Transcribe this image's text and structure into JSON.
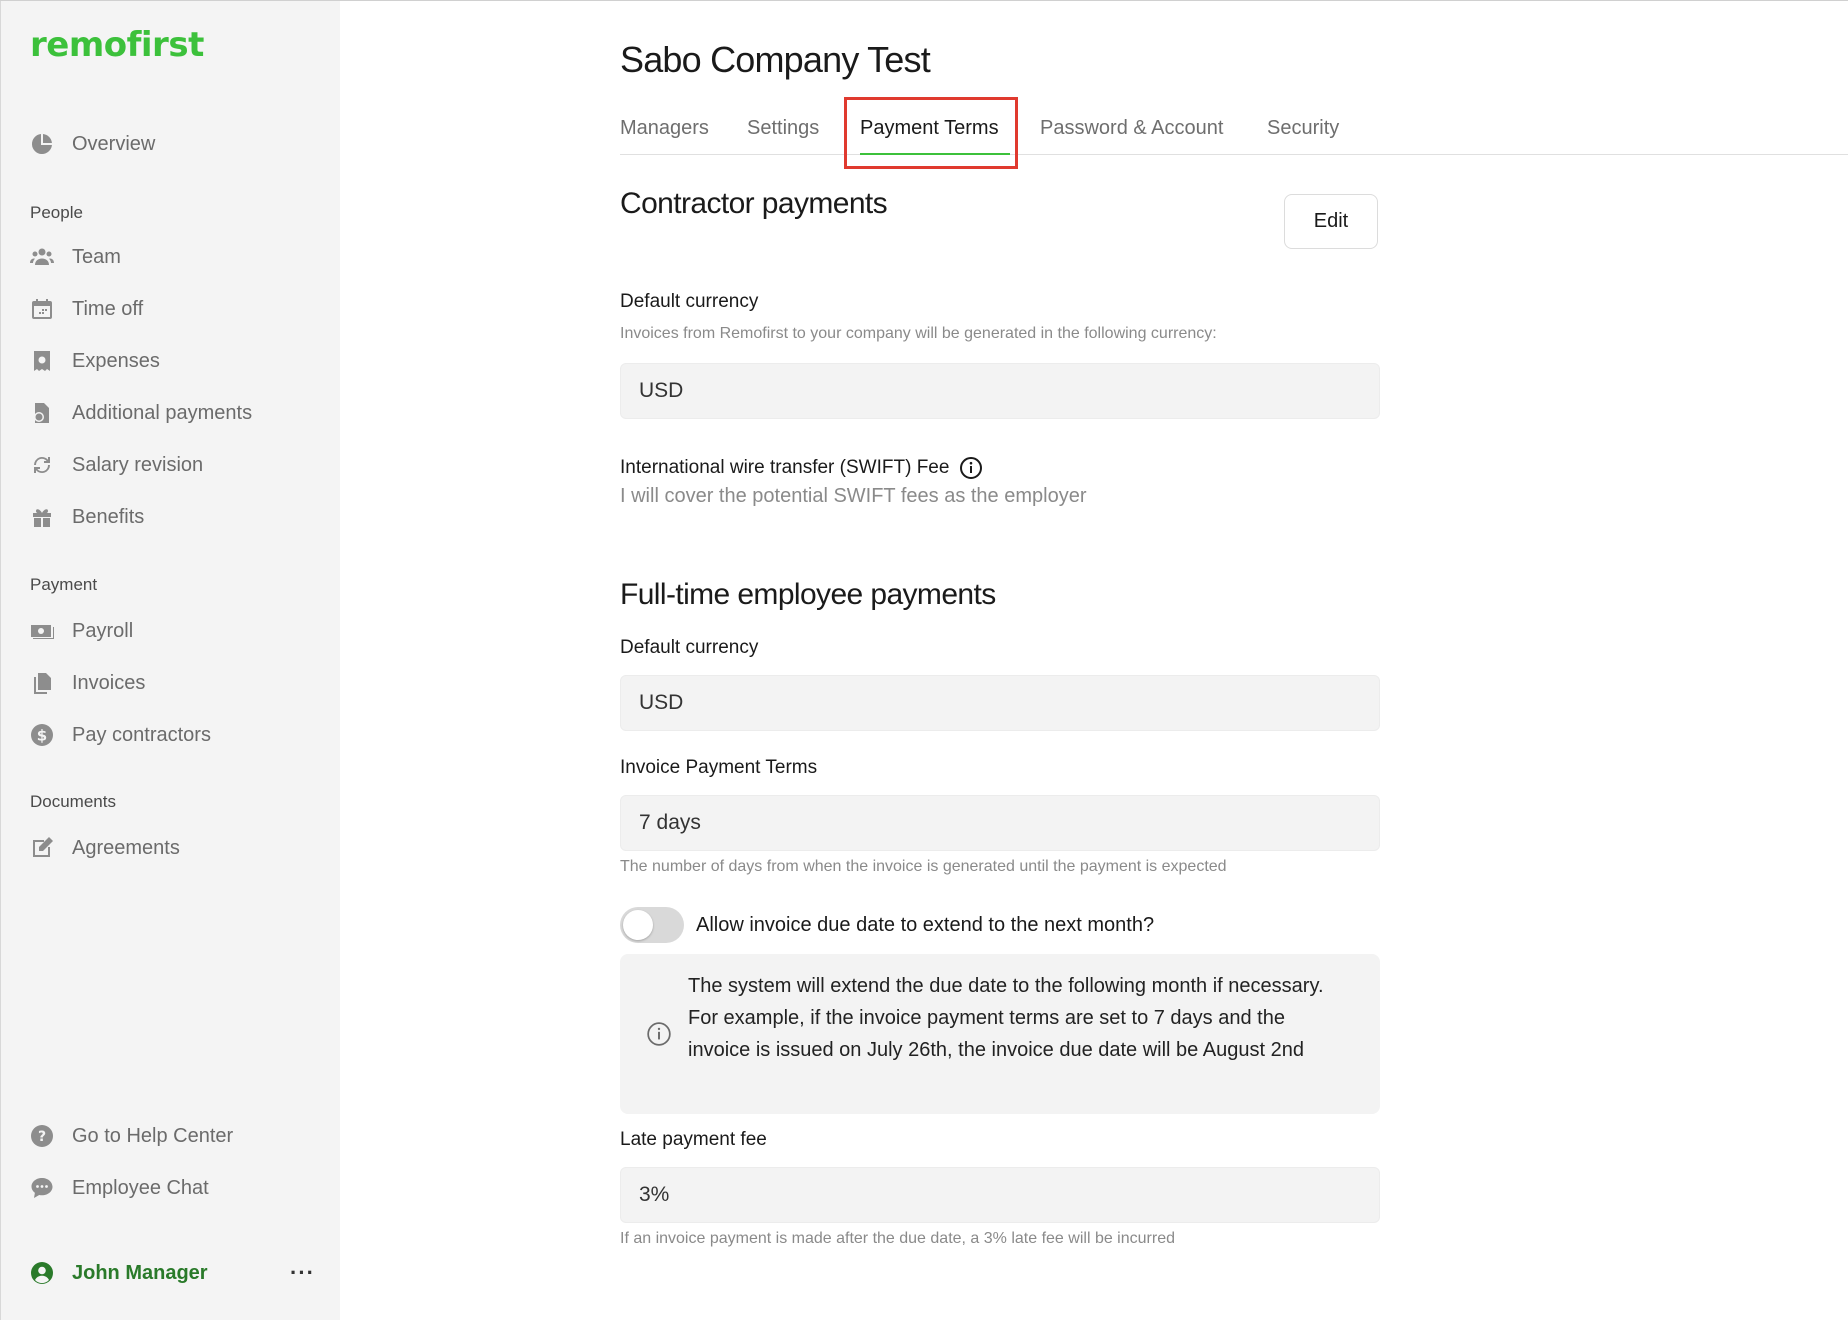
{
  "brand": {
    "logo_text": "remofirst",
    "accent": "#3cc13b"
  },
  "sidebar": {
    "overview": "Overview",
    "sections": {
      "people": "People",
      "payment": "Payment",
      "documents": "Documents"
    },
    "people_items": [
      "Team",
      "Time off",
      "Expenses",
      "Additional payments",
      "Salary revision",
      "Benefits"
    ],
    "payment_items": [
      "Payroll",
      "Invoices",
      "Pay contractors"
    ],
    "document_items": [
      "Agreements"
    ],
    "footer_items": [
      "Go to Help Center",
      "Employee Chat"
    ],
    "user": {
      "name": "John Manager",
      "more": "···"
    }
  },
  "page": {
    "title": "Sabo Company Test",
    "tabs": [
      "Managers",
      "Settings",
      "Payment Terms",
      "Password & Account",
      "Security"
    ],
    "active_tab": "Payment Terms"
  },
  "contractor": {
    "heading": "Contractor payments",
    "edit_label": "Edit",
    "currency_label": "Default currency",
    "currency_help": "Invoices from Remofirst to your company will be generated in the following currency:",
    "currency_value": "USD",
    "swift_label": "International wire transfer (SWIFT) Fee",
    "swift_value": "I will cover the potential SWIFT fees as the employer"
  },
  "fulltime": {
    "heading": "Full-time employee payments",
    "currency_label": "Default currency",
    "currency_value": "USD",
    "terms_label": "Invoice Payment Terms",
    "terms_value": "7 days",
    "terms_help": "The number of days from when the invoice is generated until the payment is expected",
    "toggle_label": "Allow invoice due date to extend to the next month?",
    "toggle_on": false,
    "info_text": "The system will extend the due date to the following month if necessary. For example, if the invoice payment terms are set to 7 days and the invoice is issued on July 26th, the invoice due date will be August 2nd",
    "late_fee_label": "Late payment fee",
    "late_fee_value": "3%",
    "late_fee_help": "If an invoice payment is made after the due date, a 3% late fee will be incurred"
  }
}
